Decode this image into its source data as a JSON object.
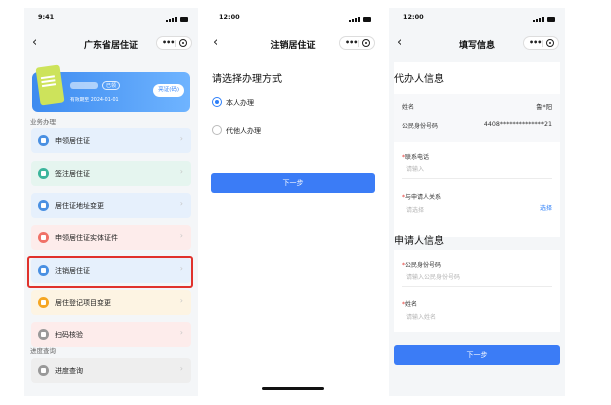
{
  "colors": {
    "accent": "#3b7cf6",
    "highlight_border": "#e0322c",
    "required": "#e0322c",
    "link": "#2d7ff9"
  },
  "screen1": {
    "status_time": "9:41",
    "nav_title": "广东省居住证",
    "card": {
      "badge": "已领",
      "valid_until": "有效期至 2024-01-01",
      "show_button": "亮证(码)"
    },
    "section_business": "业务办理",
    "items": [
      {
        "label": "申领居住证",
        "icon": "id-card-icon",
        "color": "#4a90e2",
        "bg": "#e6f0fc"
      },
      {
        "label": "签注居住证",
        "icon": "stamp-icon",
        "color": "#3cb59c",
        "bg": "#e5f5ef"
      },
      {
        "label": "居住证地址变更",
        "icon": "location-icon",
        "color": "#4a90e2",
        "bg": "#e6f0fc"
      },
      {
        "label": "申领居住证实体证件",
        "icon": "card-icon",
        "color": "#f07167",
        "bg": "#fdeceb"
      },
      {
        "label": "注销居住证",
        "icon": "cancel-card-icon",
        "color": "#4a90e2",
        "bg": "#e6f0fc"
      },
      {
        "label": "居住登记项目变更",
        "icon": "edit-icon",
        "color": "#f5a623",
        "bg": "#fdf4e3"
      },
      {
        "label": "扫码核验",
        "icon": "scan-icon",
        "color": "#999999",
        "bg": "#fdeceb"
      }
    ],
    "section_progress": "进度查询",
    "progress_item": {
      "label": "进度查询",
      "icon": "search-icon",
      "color": "#999999",
      "bg": "#eeeeee"
    }
  },
  "screen2": {
    "status_time": "12:00",
    "nav_title": "注销居住证",
    "heading": "请选择办理方式",
    "options": [
      {
        "label": "本人办理",
        "selected": true
      },
      {
        "label": "代他人办理",
        "selected": false
      }
    ],
    "next_button": "下一步"
  },
  "screen3": {
    "status_time": "12:00",
    "nav_title": "填写信息",
    "agent_section": "代办人信息",
    "name_label": "姓名",
    "name_value": "鲁*阳",
    "id_label": "公民身份号码",
    "id_value": "4408**************21",
    "phone_label": "联系电话",
    "phone_placeholder": "请输入",
    "relation_label": "与申请人关系",
    "relation_placeholder": "请选择",
    "relation_select": "选择",
    "applicant_section": "申请人信息",
    "app_id_label": "公民身份号码",
    "app_id_placeholder": "请输入公民身份号码",
    "app_name_label": "姓名",
    "app_name_placeholder": "请输入姓名",
    "next_button": "下一步"
  }
}
